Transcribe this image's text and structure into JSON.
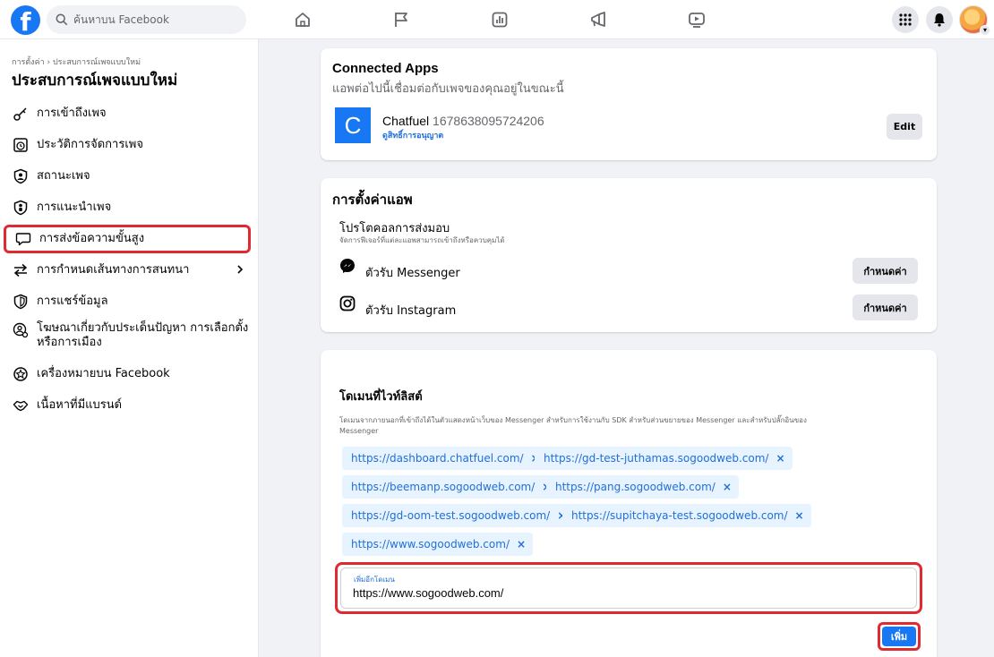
{
  "topbar": {
    "logo": "f",
    "search_placeholder": "ค้นหาบน Facebook",
    "nav_icons": [
      "home-icon",
      "flag-icon",
      "insights-icon",
      "megaphone-icon",
      "video-icon"
    ],
    "right_icons": [
      "menu-grid-icon",
      "bell-icon",
      "avatar"
    ]
  },
  "sidebar": {
    "breadcrumb": "การตั้งค่า › ประสบการณ์เพจแบบใหม่",
    "title": "ประสบการณ์เพจแบบใหม่",
    "items": [
      {
        "label": "การเข้าถึงเพจ",
        "icon": "key-icon"
      },
      {
        "label": "ประวัติการจัดการเพจ",
        "icon": "history-icon"
      },
      {
        "label": "สถานะเพจ",
        "icon": "shield-user-icon"
      },
      {
        "label": "การแนะนำเพจ",
        "icon": "shield-person-icon"
      },
      {
        "label": "การส่งข้อความขั้นสูง",
        "icon": "speech-bubble-icon",
        "active": true
      },
      {
        "label": "การกำหนดเส้นทางการสนทนา",
        "icon": "arrows-icon"
      },
      {
        "label": "การแชร์ข้อมูล",
        "icon": "shield-icon"
      },
      {
        "label": "โฆษณาเกี่ยวกับประเด็นปัญหา การเลือกตั้ง",
        "label2": "หรือการเมือง",
        "icon": "person-gear-icon"
      },
      {
        "label": "เครื่องหมายบน Facebook",
        "icon": "badge-icon"
      },
      {
        "label": "เนื้อหาที่มีแบรนด์",
        "icon": "handshake-icon"
      }
    ]
  },
  "connected_apps": {
    "title": "Connected Apps",
    "subtitle": "แอพต่อไปนี้เชื่อมต่อกับเพจของคุณอยู่ในขณะนี้",
    "app": {
      "logo_letter": "C",
      "name": "Chatfuel",
      "id": "1678638095724206",
      "permissions_link": "ดูสิทธิ์การอนุญาต",
      "edit_label": "Edit"
    }
  },
  "app_settings": {
    "title": "การตั้งค่าแอพ",
    "protocol_title": "โปรโตคอลการส่งมอบ",
    "protocol_desc": "จัดการฟีเจอร์ที่แต่ละแอพสามารถเข้าถึงหรือควบคุมได้",
    "rows": [
      {
        "icon": "messenger-icon",
        "label": "ตัวรับ Messenger",
        "button": "กำหนดค่า"
      },
      {
        "icon": "instagram-icon",
        "label": "ตัวรับ Instagram",
        "button": "กำหนดค่า"
      }
    ]
  },
  "whitelist": {
    "title": "โดเมนที่ไวท์ลิสต์",
    "desc_line1": "โดเมนจากภายนอกที่เข้าถึงได้ในตัวแสดงหน้าเว็บของ Messenger สำหรับการใช้งานกับ SDK สำหรับส่วนขยายของ Messenger และสำหรับปลั๊กอินของ",
    "desc_line2": "Messenger",
    "domains": [
      "https://dashboard.chatfuel.com/",
      "https://gd-test-juthamas.sogoodweb.com/",
      "https://beemanp.sogoodweb.com/",
      "https://pang.sogoodweb.com/",
      "https://gd-oom-test.sogoodweb.com/",
      "https://supitchaya-test.sogoodweb.com/",
      "https://www.sogoodweb.com/"
    ],
    "remove_glyph": "×",
    "input_label": "เพิ่มอีกโดเมน",
    "input_value": "https://www.sogoodweb.com/",
    "add_button": "เพิ่ม"
  },
  "colors": {
    "accent": "#1877f2",
    "highlight": "#e02a32",
    "chip_bg": "#e7f3ff",
    "chip_text": "#216fdb"
  }
}
